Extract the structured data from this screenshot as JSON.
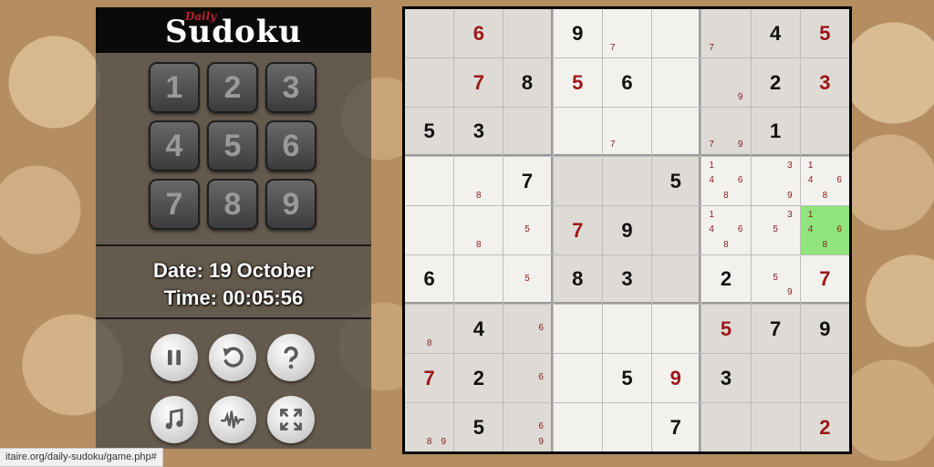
{
  "logo": {
    "small": "Daily",
    "main": "Sudoku"
  },
  "numpad": [
    "1",
    "2",
    "3",
    "4",
    "5",
    "6",
    "7",
    "8",
    "9"
  ],
  "info": {
    "date": "Date: 19 October",
    "time": "Time: 00:05:56"
  },
  "controls": [
    {
      "name": "pause-button",
      "icon": "pause-icon"
    },
    {
      "name": "undo-button",
      "icon": "undo-icon"
    },
    {
      "name": "help-button",
      "icon": "question-icon"
    },
    {
      "name": "music-button",
      "icon": "music-note-icon"
    },
    {
      "name": "sound-button",
      "icon": "waveform-icon"
    },
    {
      "name": "fullscreen-button",
      "icon": "expand-icon"
    }
  ],
  "status_url": "itaire.org/daily-sudoku/game.php#",
  "board": [
    [
      "",
      "6r",
      "",
      "9",
      "",
      "",
      "",
      "4",
      "5r"
    ],
    [
      "",
      "7r",
      "8",
      "5r",
      "6",
      "",
      "",
      "2",
      "3r"
    ],
    [
      "5",
      "3",
      "",
      "",
      "",
      "",
      "",
      "1",
      ""
    ],
    [
      "",
      "",
      "7",
      "",
      "",
      "5",
      "",
      "",
      ""
    ],
    [
      "",
      "",
      "",
      "7r",
      "9",
      "",
      "",
      "",
      ""
    ],
    [
      "6",
      "",
      "",
      "8",
      "3",
      "",
      "2",
      "",
      "7r"
    ],
    [
      "",
      "4",
      "",
      "",
      "",
      "",
      "5r",
      "7",
      "9"
    ],
    [
      "7r",
      "2",
      "",
      "",
      "5",
      "9r",
      "3",
      "",
      ""
    ],
    [
      "",
      "5",
      "",
      "",
      "",
      "7",
      "",
      "",
      "2r"
    ]
  ],
  "candidates": {
    "0,4": [
      "",
      "",
      "",
      "",
      "",
      "",
      "7",
      "",
      ""
    ],
    "0,6": [
      "",
      "",
      "",
      "",
      "",
      "",
      "7",
      "",
      ""
    ],
    "1,6": [
      "",
      "",
      "",
      "",
      "",
      "",
      "",
      "",
      "9"
    ],
    "2,4": [
      "",
      "",
      "",
      "",
      "",
      "",
      "7",
      "",
      ""
    ],
    "2,6": [
      "",
      "",
      "",
      "",
      "",
      "",
      "7",
      "",
      "9"
    ],
    "3,1": [
      "",
      "",
      "",
      "",
      "",
      "",
      "",
      "8",
      ""
    ],
    "3,6": [
      "1",
      "",
      "",
      "4",
      "",
      "6",
      "",
      "8",
      ""
    ],
    "3,7": [
      "",
      "",
      "3",
      "",
      "",
      "",
      "",
      "",
      "9"
    ],
    "3,8": [
      "1",
      "",
      "",
      "4",
      "",
      "6",
      "",
      "8",
      ""
    ],
    "4,1": [
      "",
      "",
      "",
      "",
      "",
      "",
      "",
      "8",
      ""
    ],
    "4,2": [
      "",
      "",
      "",
      "",
      "5",
      "",
      "",
      "",
      ""
    ],
    "4,6": [
      "1",
      "",
      "",
      "4",
      "",
      "6",
      "",
      "8",
      ""
    ],
    "4,7": [
      "",
      "",
      "3",
      "",
      "5",
      "",
      "",
      "",
      ""
    ],
    "4,8": [
      "1",
      "",
      "",
      "4",
      "",
      "6",
      "",
      "8",
      ""
    ],
    "5,2": [
      "",
      "",
      "",
      "",
      "5",
      "",
      "",
      "",
      ""
    ],
    "5,7": [
      "",
      "",
      "",
      "",
      "5",
      "",
      "",
      "",
      "9"
    ],
    "6,0": [
      "",
      "",
      "",
      "",
      "",
      "",
      "",
      "8",
      ""
    ],
    "6,2": [
      "",
      "",
      "",
      "",
      "",
      "6",
      "",
      "",
      ""
    ],
    "7,2": [
      "",
      "",
      "",
      "",
      "",
      "6",
      "",
      "",
      ""
    ],
    "8,0": [
      "",
      "",
      "",
      "",
      "",
      "",
      "",
      "8",
      "9"
    ],
    "8,2": [
      "",
      "",
      "",
      "",
      "",
      "6",
      "",
      "",
      "9"
    ]
  },
  "selected": "4,8",
  "colors": {
    "given": "#111111",
    "entered": "#9d1717",
    "selected": "#90e57c",
    "shade": "#dedad6",
    "light": "#f3f1ee"
  }
}
